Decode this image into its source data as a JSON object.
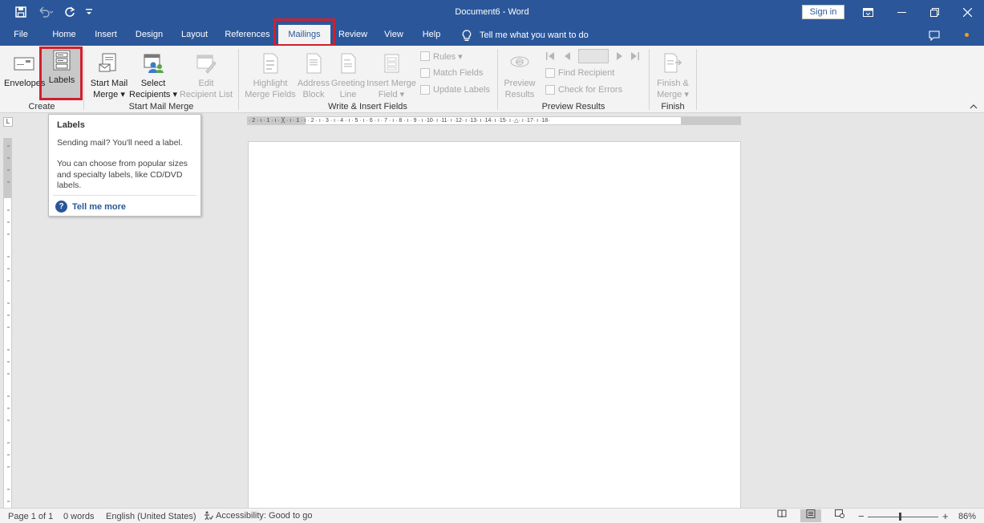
{
  "window": {
    "title": "Document6",
    "app": "Word",
    "sign_in": "Sign in"
  },
  "quick_access": [
    "save-icon",
    "undo-icon",
    "redo-icon",
    "customize-qat-icon"
  ],
  "tabs": [
    {
      "label": "File"
    },
    {
      "label": "Home"
    },
    {
      "label": "Insert"
    },
    {
      "label": "Design"
    },
    {
      "label": "Layout"
    },
    {
      "label": "References"
    },
    {
      "label": "Mailings",
      "active": true
    },
    {
      "label": "Review"
    },
    {
      "label": "View"
    },
    {
      "label": "Help"
    }
  ],
  "tell_me": "Tell me what you want to do",
  "ribbon": {
    "create": {
      "label": "Create",
      "envelopes": "Envelopes",
      "labels": "Labels"
    },
    "start_mail_merge": {
      "label": "Start Mail Merge",
      "start_line1": "Start Mail",
      "start_line2": "Merge ▾",
      "select_line1": "Select",
      "select_line2": "Recipients ▾",
      "edit_line1": "Edit",
      "edit_line2": "Recipient List"
    },
    "write_insert": {
      "label": "Write & Insert Fields",
      "highlight_line1": "Highlight",
      "highlight_line2": "Merge Fields",
      "address_line1": "Address",
      "address_line2": "Block",
      "greeting_line1": "Greeting",
      "greeting_line2": "Line",
      "insert_line1": "Insert Merge",
      "insert_line2": "Field ▾",
      "rules": "Rules ▾",
      "match_fields": "Match Fields",
      "update_labels": "Update Labels"
    },
    "preview_results": {
      "label": "Preview Results",
      "preview_line1": "Preview",
      "preview_line2": "Results",
      "find_recipient": "Find Recipient",
      "check_errors": "Check for Errors"
    },
    "finish": {
      "label": "Finish",
      "finish_line1": "Finish &",
      "finish_line2": "Merge ▾"
    }
  },
  "tooltip": {
    "title": "Labels",
    "line1": "Sending mail? You'll need a label.",
    "line2": "You can choose from popular sizes and specialty labels, like CD/DVD labels.",
    "more": "Tell me more"
  },
  "ruler": {
    "corner": "L",
    "text": "· 2 · ı · 1 · ı · ╳ · ı · 1 · ı · 2 · ı · 3 · ı · 4 · ı · 5 · ı · 6 · ı · 7 · ı · 8 · ı · 9 · ı ·10· ı ·11· ı ·12· ı ·13· ı ·14· ı ·15· ı ·△· ı ·17· ı ·18·"
  },
  "status": {
    "page": "Page 1 of 1",
    "words": "0 words",
    "language": "English (United States)",
    "accessibility": "Accessibility: Good to go",
    "zoom": "86%"
  }
}
